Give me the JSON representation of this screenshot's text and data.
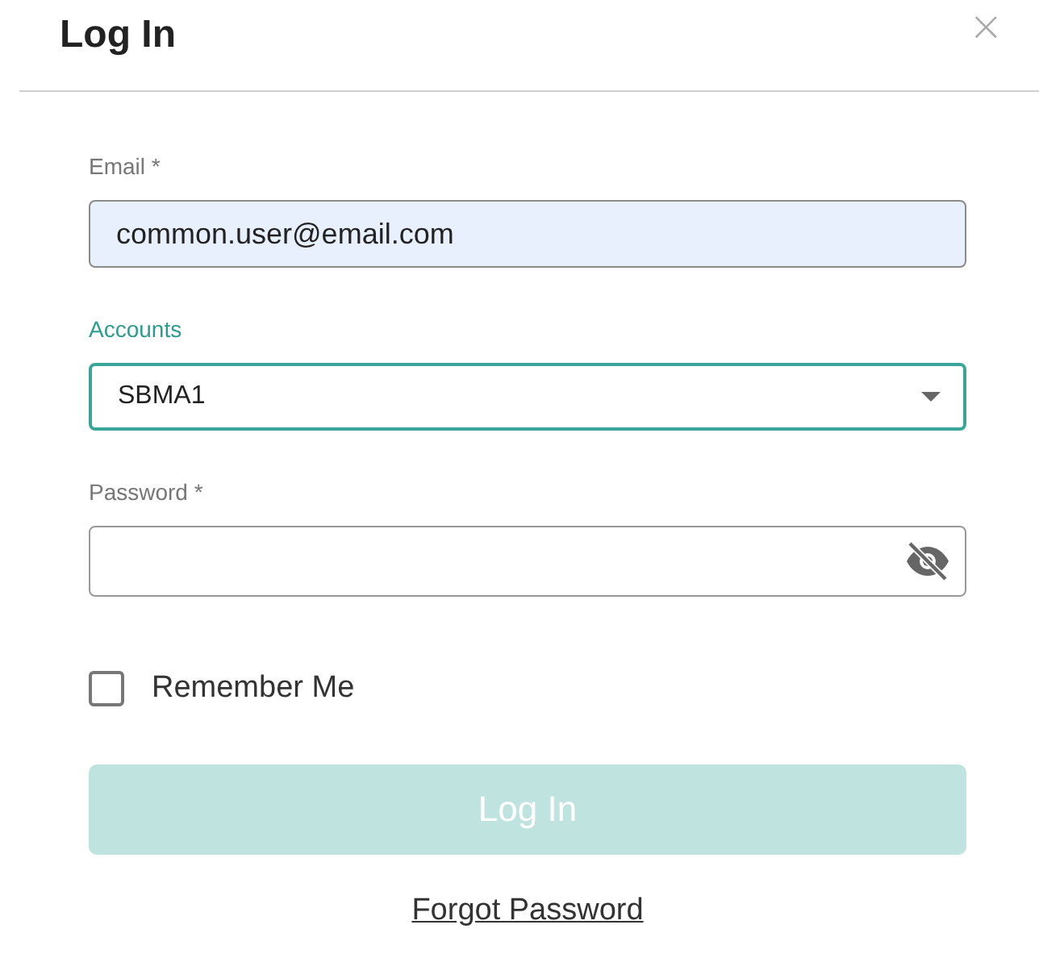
{
  "dialog": {
    "title": "Log In",
    "close": "×"
  },
  "email": {
    "label": "Email",
    "required_mark": "*",
    "value": "common.user@email.com",
    "autofilled": true
  },
  "accounts": {
    "label": "Accounts",
    "value": "SBMA1",
    "focused": true
  },
  "password": {
    "label": "Password",
    "required_mark": "*"
  },
  "remember_me": {
    "label": "Remember Me",
    "checked": false
  },
  "login_button": {
    "label": "Log In",
    "disabled": true
  },
  "forgot_password": "Forgot Password"
}
